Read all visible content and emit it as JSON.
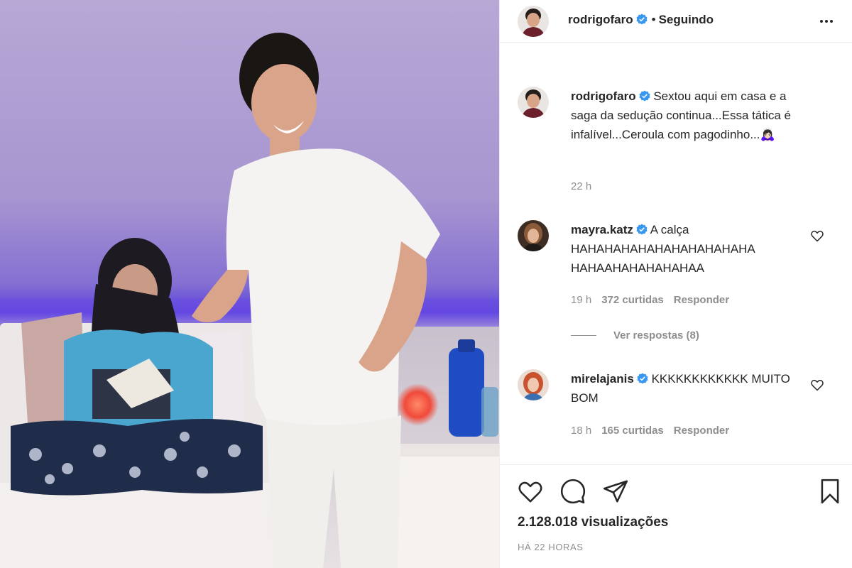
{
  "header": {
    "username": "rodrigofaro",
    "separator": "•",
    "follow_status": "Seguindo"
  },
  "caption": {
    "username": "rodrigofaro",
    "text": "Sextou aqui em casa e a saga da sedução continua...Essa tática é infalível...Ceroula com pagodinho...🙇🏻‍♀️",
    "time": "22 h"
  },
  "comments": [
    {
      "username": "mayra.katz",
      "text": "A calça HAHAHAHAHAHAHAHAHAHAHA HAHAAHAHAHAHAHAA",
      "time": "19 h",
      "likes": "372 curtidas",
      "reply": "Responder",
      "replies_label": "Ver respostas (8)"
    },
    {
      "username": "mirelajanis",
      "text": "KKKKKKKKKKKK MUITO BOM",
      "time": "18 h",
      "likes": "165 curtidas",
      "reply": "Responder"
    }
  ],
  "footer": {
    "views": "2.128.018 visualizações",
    "posted": "HÁ 22 HORAS"
  },
  "icons": {
    "like": "heart-icon",
    "comment": "comment-bubble-icon",
    "share": "paper-plane-icon",
    "save": "bookmark-icon",
    "more": "more-options-icon",
    "verified": "verified-badge-icon"
  },
  "colors": {
    "verified_blue": "#3897f0",
    "secondary_text": "#8e8e8e",
    "primary_text": "#262626"
  }
}
